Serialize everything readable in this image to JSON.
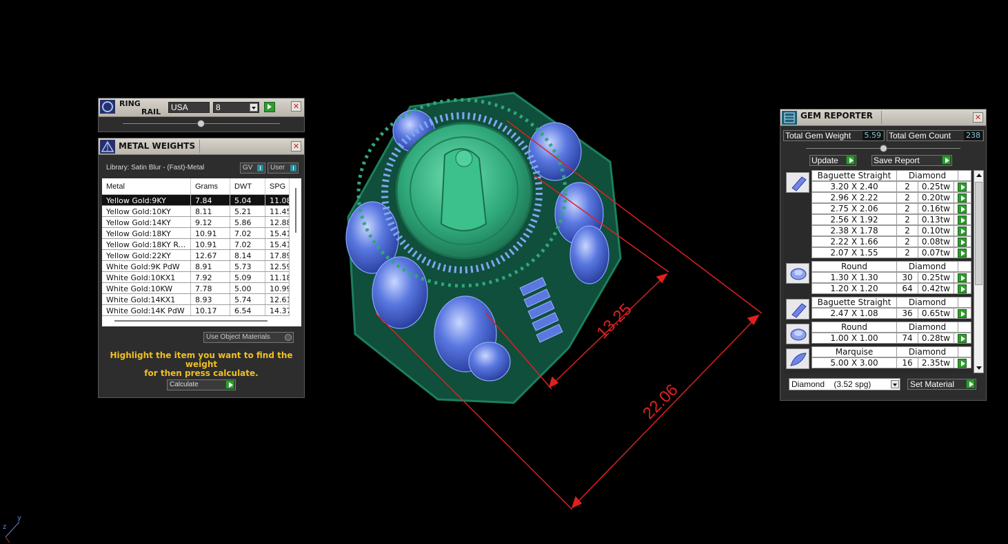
{
  "ring_rail": {
    "title_line1": "RING",
    "title_line2": "RAIL",
    "country": "USA",
    "size": "8"
  },
  "metal_weights": {
    "title": "METAL WEIGHTS",
    "library": "Library: Satin Blur - (Fast)-Metal",
    "toggle_gv": "GV",
    "toggle_user": "User",
    "columns": [
      "Metal",
      "Grams",
      "DWT",
      "SPG"
    ],
    "rows": [
      {
        "metal": "Yellow Gold:9KY",
        "grams": "7.84",
        "dwt": "5.04",
        "spg": "11.08"
      },
      {
        "metal": "Yellow Gold:10KY",
        "grams": "8.11",
        "dwt": "5.21",
        "spg": "11.45"
      },
      {
        "metal": "Yellow Gold:14KY",
        "grams": "9.12",
        "dwt": "5.86",
        "spg": "12.88"
      },
      {
        "metal": "Yellow Gold:18KY",
        "grams": "10.91",
        "dwt": "7.02",
        "spg": "15.41"
      },
      {
        "metal": "Yellow Gold:18KY R...",
        "grams": "10.91",
        "dwt": "7.02",
        "spg": "15.41"
      },
      {
        "metal": "Yellow Gold:22KY",
        "grams": "12.67",
        "dwt": "8.14",
        "spg": "17.89"
      },
      {
        "metal": "White Gold:9K PdW",
        "grams": "8.91",
        "dwt": "5.73",
        "spg": "12.59"
      },
      {
        "metal": "White Gold:10KX1",
        "grams": "7.92",
        "dwt": "5.09",
        "spg": "11.18"
      },
      {
        "metal": "White Gold:10KW",
        "grams": "7.78",
        "dwt": "5.00",
        "spg": "10.99"
      },
      {
        "metal": "White Gold:14KX1",
        "grams": "8.93",
        "dwt": "5.74",
        "spg": "12.61"
      },
      {
        "metal": "White Gold:14K PdW",
        "grams": "10.17",
        "dwt": "6.54",
        "spg": "14.37"
      }
    ],
    "use_object_materials": "Use Object Materials",
    "instruction_line1": "Highlight the item you want to find the weight",
    "instruction_line2": "for then press calculate.",
    "calculate": "Calculate"
  },
  "gem_reporter": {
    "title": "GEM REPORTER",
    "total_weight_label": "Total Gem Weight",
    "total_weight": "5.59",
    "total_count_label": "Total Gem Count",
    "total_count": "238",
    "update": "Update",
    "save_report": "Save Report",
    "groups": [
      {
        "shape": "Baguette Straight",
        "material": "Diamond",
        "icon": "baguette-gem-icon",
        "rows": [
          {
            "size": "3.20 X 2.40",
            "count": "2",
            "weight": "0.25tw"
          },
          {
            "size": "2.96 X 2.22",
            "count": "2",
            "weight": "0.20tw"
          },
          {
            "size": "2.75 X 2.06",
            "count": "2",
            "weight": "0.16tw"
          },
          {
            "size": "2.56 X 1.92",
            "count": "2",
            "weight": "0.13tw"
          },
          {
            "size": "2.38 X 1.78",
            "count": "2",
            "weight": "0.10tw"
          },
          {
            "size": "2.22 X 1.66",
            "count": "2",
            "weight": "0.08tw"
          },
          {
            "size": "2.07 X 1.55",
            "count": "2",
            "weight": "0.07tw"
          }
        ]
      },
      {
        "shape": "Round",
        "material": "Diamond",
        "icon": "round-gem-icon",
        "rows": [
          {
            "size": "1.30 X 1.30",
            "count": "30",
            "weight": "0.25tw"
          },
          {
            "size": "1.20 X 1.20",
            "count": "64",
            "weight": "0.42tw"
          }
        ]
      },
      {
        "shape": "Baguette Straight",
        "material": "Diamond",
        "icon": "baguette-gem-icon",
        "rows": [
          {
            "size": "2.47 X 1.08",
            "count": "36",
            "weight": "0.65tw"
          }
        ]
      },
      {
        "shape": "Round",
        "material": "Diamond",
        "icon": "round-gem-icon",
        "rows": [
          {
            "size": "1.00 X 1.00",
            "count": "74",
            "weight": "0.28tw"
          }
        ]
      },
      {
        "shape": "Marquise",
        "material": "Diamond",
        "icon": "marquise-gem-icon",
        "rows": [
          {
            "size": "5.00 X 3.00",
            "count": "16",
            "weight": "2.35tw"
          }
        ]
      }
    ],
    "material_select": "Diamond    (3.52 spg)",
    "set_material": "Set Material"
  },
  "viewport": {
    "dimension_small": "13.25",
    "dimension_large": "22.06",
    "axis_y": "y",
    "axis_z": "z",
    "colors": {
      "metal": "#2fa87a",
      "gem": "#5a78e0",
      "dimension": "#e02020"
    }
  }
}
